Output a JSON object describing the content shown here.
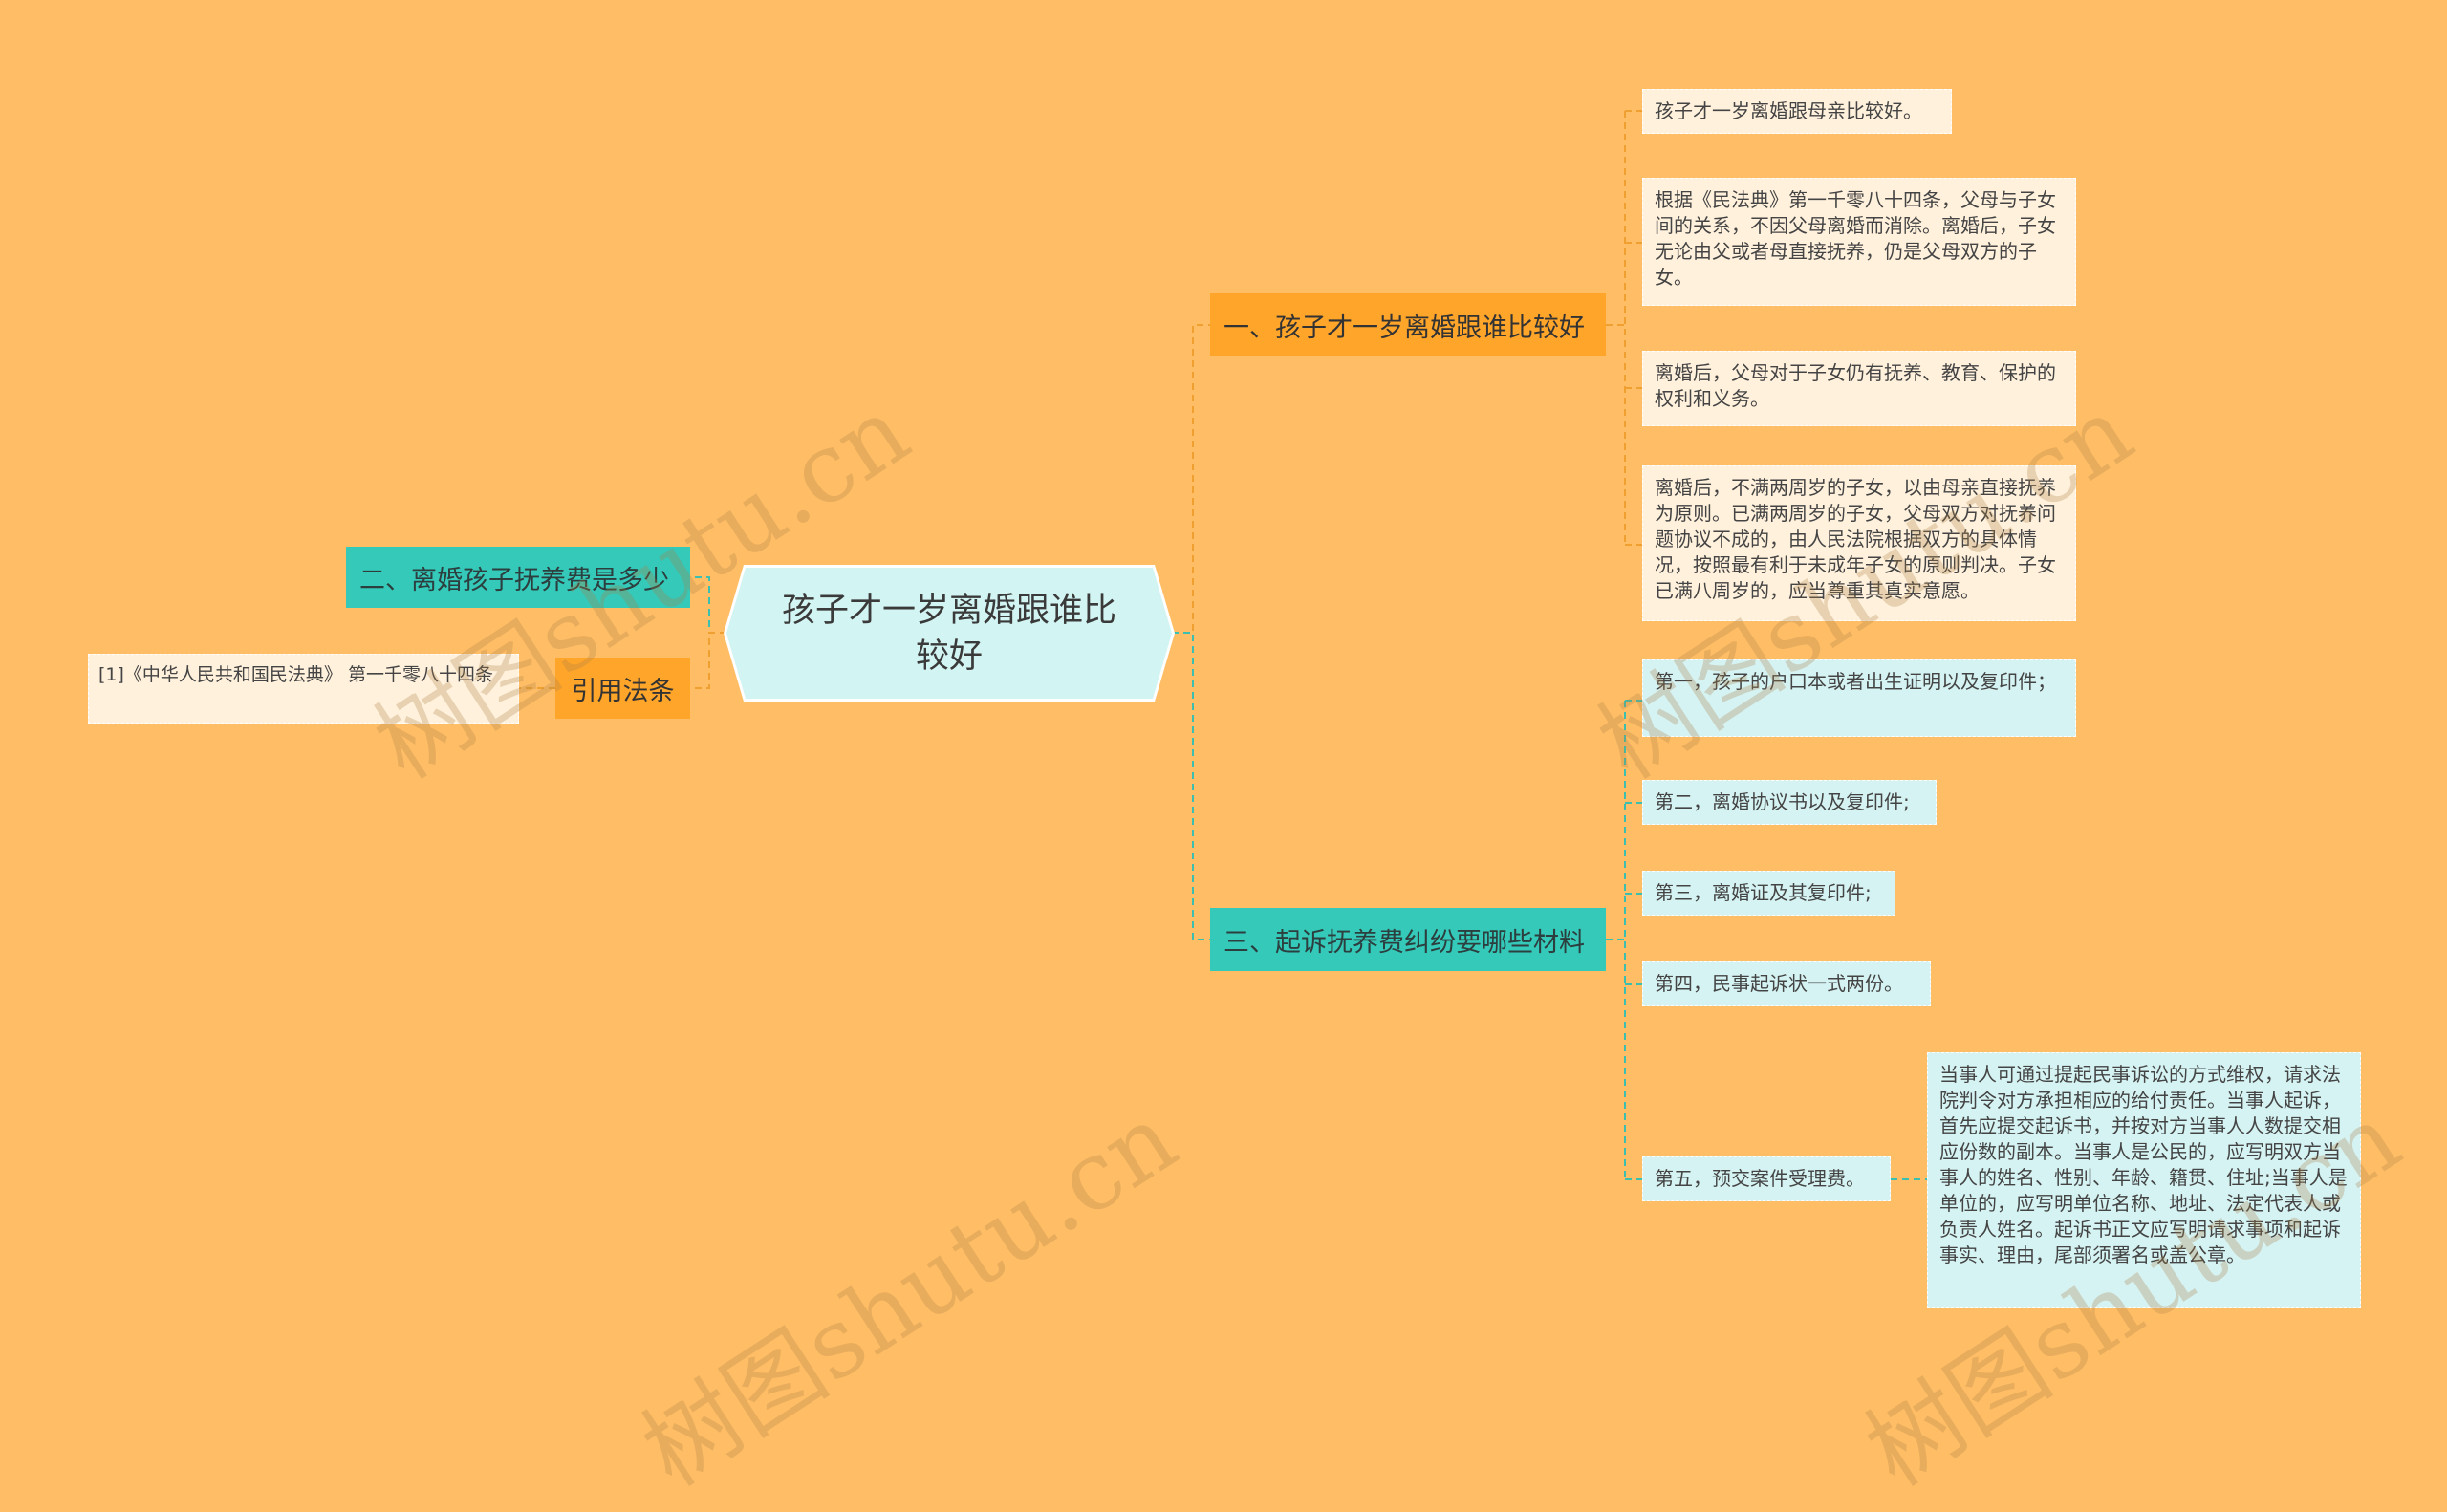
{
  "root": {
    "title": "孩子才一岁离婚跟谁比较好"
  },
  "branches": {
    "b1": {
      "label": "一、孩子才一岁离婚跟谁比较好"
    },
    "b2": {
      "label": "二、离婚孩子抚养费是多少"
    },
    "b3": {
      "label": "三、起诉抚养费纠纷要哪些材料"
    },
    "cite": {
      "label": "引用法条"
    }
  },
  "leaves": {
    "l1": "孩子才一岁离婚跟母亲比较好。",
    "l2": "根据《民法典》第一千零八十四条，父母与子女间的关系，不因父母离婚而消除。离婚后，子女无论由父或者母直接抚养，仍是父母双方的子女。",
    "l3": "离婚后，父母对于子女仍有抚养、教育、保护的权利和义务。",
    "l4": "离婚后，不满两周岁的子女，以由母亲直接抚养为原则。已满两周岁的子女，父母双方对抚养问题协议不成的，由人民法院根据双方的具体情况，按照最有利于未成年子女的原则判决。子女已满八周岁的，应当尊重其真实意愿。",
    "m1": "第一，孩子的户口本或者出生证明以及复印件；",
    "m2": "第二，离婚协议书以及复印件;",
    "m3": "第三，离婚证及其复印件;",
    "m4": "第四，民事起诉状一式两份。",
    "m5": "第五，预交案件受理费。",
    "m5_detail": "当事人可通过提起民事诉讼的方式维权，请求法院判令对方承担相应的给付责任。当事人起诉，首先应提交起诉书，并按对方当事人人数提交相应份数的副本。当事人是公民的，应写明双方当事人的姓名、性别、年龄、籍贯、住址;当事人是单位的，应写明单位名称、地址、法定代表人或负责人姓名。起诉书正文应写明请求事项和起诉事实、理由，尾部须署名或盖公章。",
    "cite_item": "[1]《中华人民共和国民法典》 第一千零八十四条"
  },
  "watermark": {
    "text": "树图shutu.cn"
  },
  "colors": {
    "background": "#ffbe66",
    "orange_node": "#ffa52a",
    "teal_node": "#35c9b9",
    "root_fill": "#d2f4f2",
    "orange_line": "#f0a030",
    "teal_line": "#3cbfae"
  }
}
